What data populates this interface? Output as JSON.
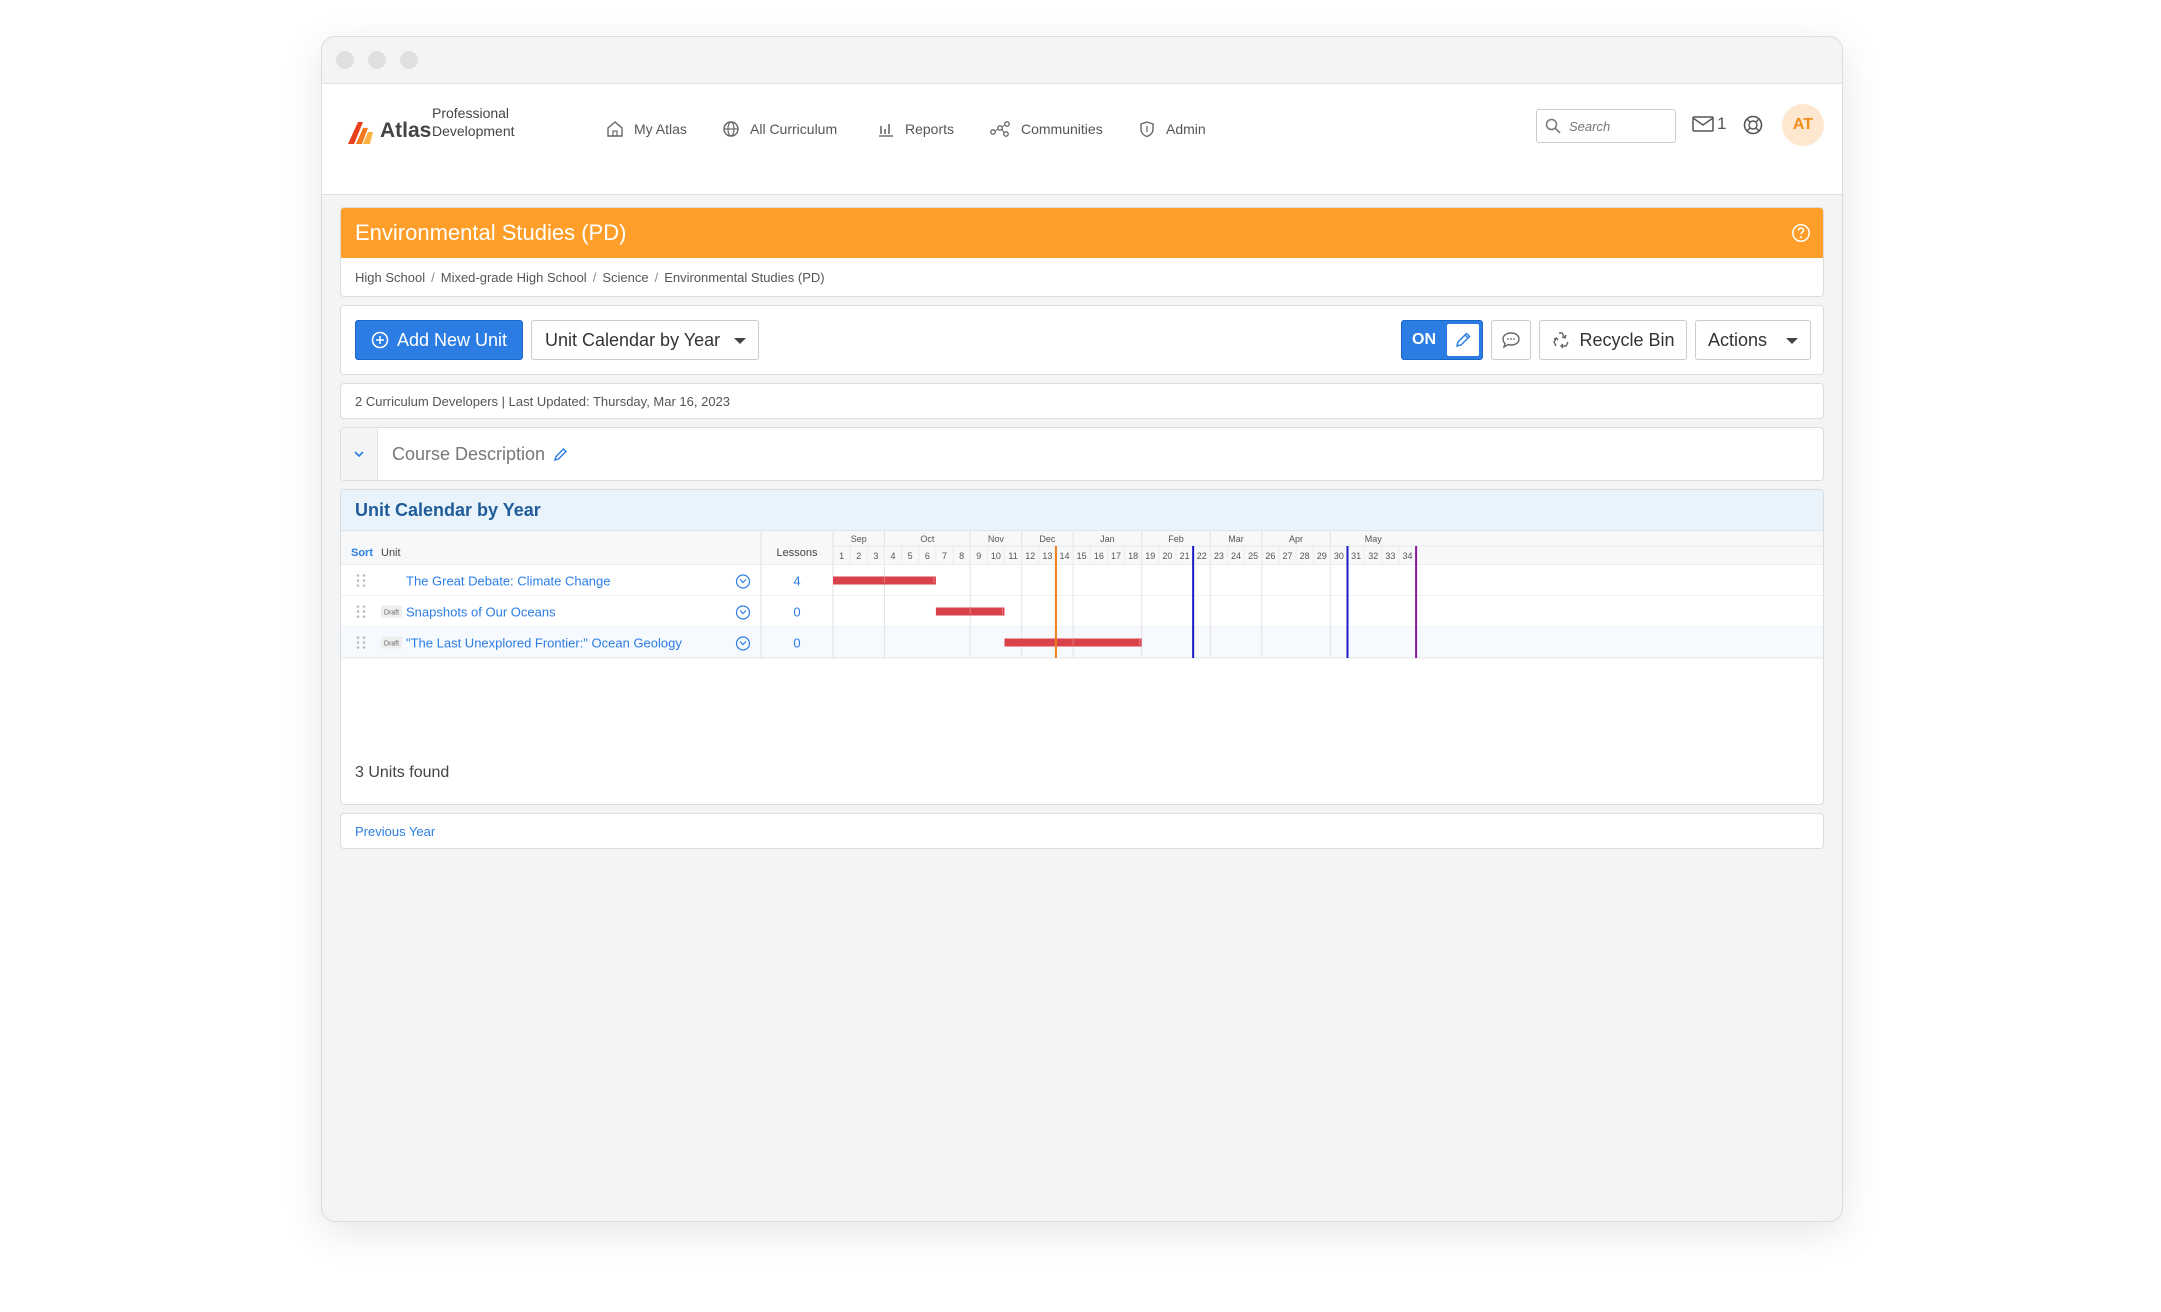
{
  "nav": {
    "logo": "Atlas",
    "logo_sub": "Professional Development",
    "items": [
      {
        "label": "My Atlas",
        "icon": "home-icon"
      },
      {
        "label": "All Curriculum",
        "icon": "globe-icon"
      },
      {
        "label": "Reports",
        "icon": "bar-chart-icon"
      },
      {
        "label": "Communities",
        "icon": "network-icon"
      },
      {
        "label": "Admin",
        "icon": "shield-icon"
      }
    ],
    "search_placeholder": "Search",
    "mail_count": "1",
    "avatar_initials": "AT"
  },
  "course": {
    "title": "Environmental Studies (PD)",
    "breadcrumb": [
      "High School",
      "Mixed-grade High School",
      "Science",
      "Environmental Studies (PD)"
    ]
  },
  "toolbar": {
    "add_unit": "Add New Unit",
    "view_select": "Unit Calendar by Year",
    "toggle": "ON",
    "recycle_bin": "Recycle Bin",
    "actions": "Actions"
  },
  "meta": "2 Curriculum Developers | Last Updated: Thursday, Mar 16, 2023",
  "course_description_label": "Course Description",
  "calendar": {
    "heading": "Unit Calendar by Year",
    "col_sort": "Sort",
    "col_unit": "Unit",
    "col_lessons": "Lessons",
    "months": [
      "Sep",
      "Oct",
      "Nov",
      "Dec",
      "Jan",
      "Feb",
      "Mar",
      "Apr",
      "May"
    ],
    "weeks": [
      "1",
      "2",
      "3",
      "4",
      "5",
      "6",
      "7",
      "8",
      "9",
      "10",
      "11",
      "12",
      "13",
      "14",
      "15",
      "16",
      "17",
      "18",
      "19",
      "20",
      "21",
      "22",
      "23",
      "24",
      "25",
      "26",
      "27",
      "28",
      "29",
      "30",
      "31",
      "32",
      "33",
      "34"
    ],
    "units": [
      {
        "name": "The Great Debate: Climate Change",
        "draft": false,
        "draft_label": "",
        "lessons": "4"
      },
      {
        "name": "Snapshots of Our Oceans",
        "draft": true,
        "draft_label": "Draft",
        "lessons": "0"
      },
      {
        "name": "\"The Last Unexplored Frontier:\" Ocean Geology",
        "draft": true,
        "draft_label": "Draft",
        "lessons": "0"
      }
    ],
    "found_text": "3 Units found"
  },
  "prev_year": "Previous Year",
  "colors": {
    "accent": "#2b7de4",
    "orange": "#ff9f2a",
    "bar": "#d9424a",
    "today_line": "#f07d1e",
    "marker_blue": "#1c1cc4",
    "marker_purple": "#8a1a9b"
  }
}
